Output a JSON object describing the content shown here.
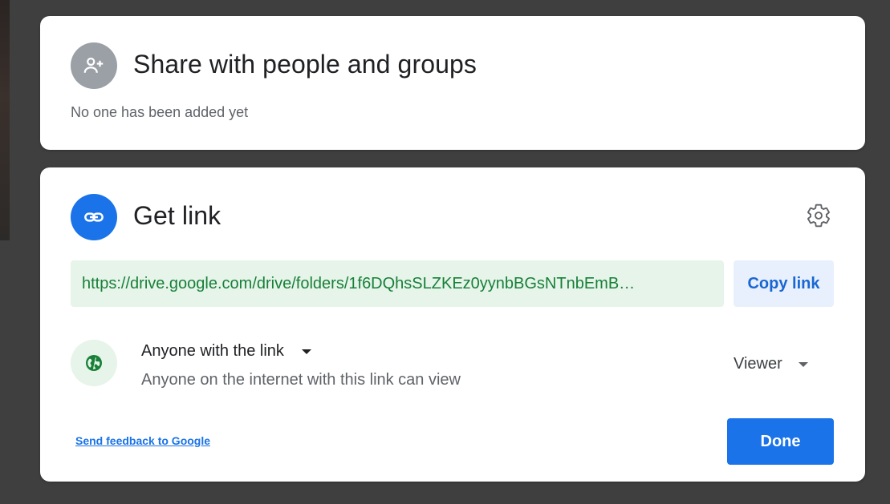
{
  "share": {
    "title": "Share with people and groups",
    "status": "No one has been added yet",
    "icon": "person-add-icon"
  },
  "link": {
    "title": "Get link",
    "icon": "link-icon",
    "settings_icon": "gear-icon",
    "url": "https://drive.google.com/drive/folders/1f6DQhsSLZKEz0yynbBGsNTnbEmB…",
    "copy_label": "Copy link",
    "access": {
      "label": "Anyone with the link",
      "description": "Anyone on the internet with this link can view",
      "icon": "globe-icon"
    },
    "role": {
      "selected": "Viewer"
    }
  },
  "footer": {
    "feedback_label": "Send feedback to Google",
    "done_label": "Done"
  },
  "colors": {
    "backdrop": "#3f3f3f",
    "accent_blue": "#1a73e8",
    "link_green": "#188038",
    "link_bg": "#e6f4ea",
    "copy_bg": "#e8f0fe",
    "neutral_gray": "#9aa0a6"
  }
}
